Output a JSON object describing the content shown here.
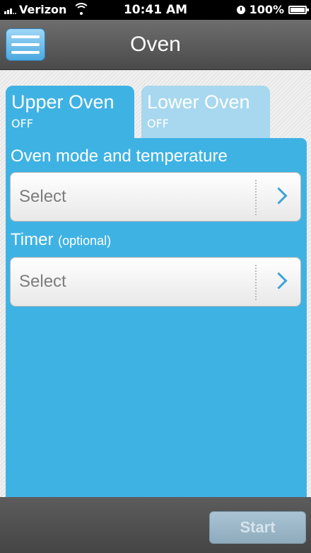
{
  "status_bar": {
    "carrier": "Verizon",
    "time": "10:41 AM",
    "battery": "100%"
  },
  "header": {
    "title": "Oven",
    "menu_icon": "hamburger-menu-icon"
  },
  "tabs": [
    {
      "label": "Upper Oven",
      "status": "OFF",
      "selected": true
    },
    {
      "label": "Lower Oven",
      "status": "OFF",
      "selected": false
    }
  ],
  "form": {
    "mode": {
      "label": "Oven mode and temperature",
      "value": "Select"
    },
    "timer": {
      "label": "Timer",
      "optional": "(optional)",
      "value": "Select"
    }
  },
  "footer": {
    "start_label": "Start",
    "start_enabled": false
  },
  "colors": {
    "accent": "#3fb2e4",
    "tab_inactive": "#a7d8ef",
    "header": "#555555"
  }
}
